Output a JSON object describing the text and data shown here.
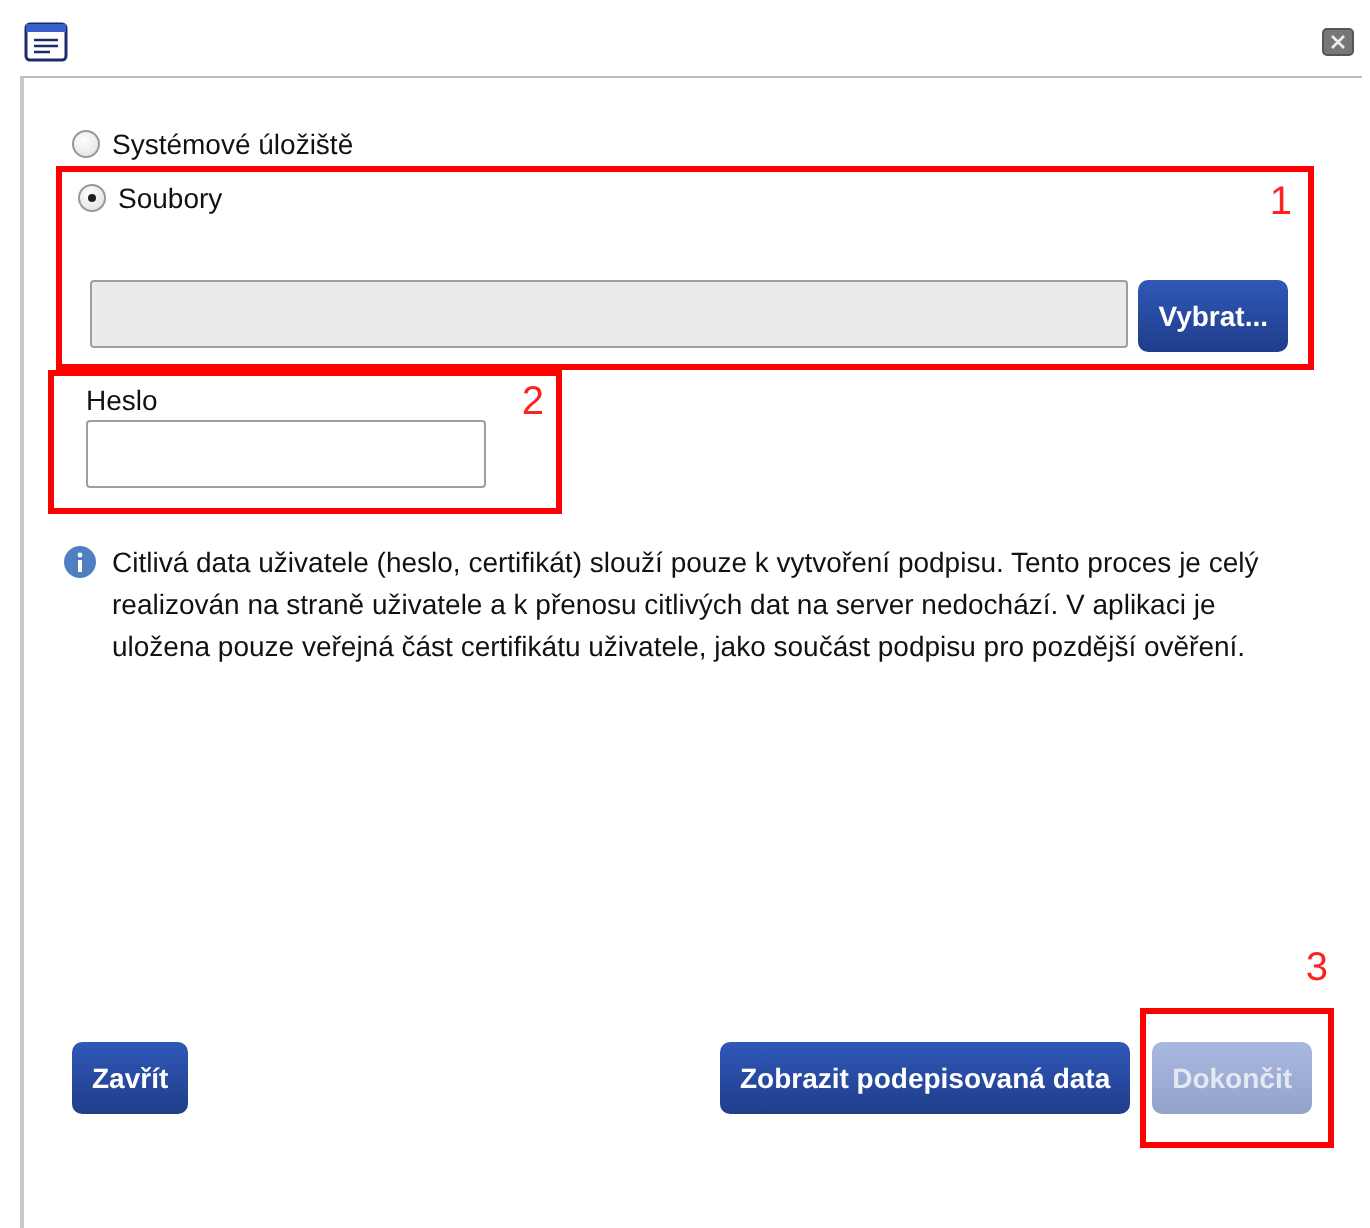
{
  "storage_options": [
    {
      "label": "Systémové úložiště",
      "selected": false
    },
    {
      "label": "Soubory",
      "selected": true
    }
  ],
  "file_field": {
    "disabled": true
  },
  "browse_button": {
    "label": "Vybrat..."
  },
  "password": {
    "label": "Heslo"
  },
  "info": "Citlivá data uživatele (heslo, certifikát) slouží pouze k vytvoření podpisu. Tento proces je celý realizován na straně uživatele a k přenosu citlivých dat na server nedochází. V aplikaci je uložena pouze veřejná část certifikátu uživatele, jako součást podpisu pro pozdější ověření.",
  "buttons": [
    {
      "label": "Zavřít",
      "disabled": false
    },
    {
      "label": "Zobrazit podepisovaná data",
      "disabled": false
    },
    {
      "label": "Dokončit",
      "disabled": true
    }
  ],
  "annotations": [
    {
      "label": "1"
    },
    {
      "label": "2"
    },
    {
      "label": "3"
    }
  ]
}
